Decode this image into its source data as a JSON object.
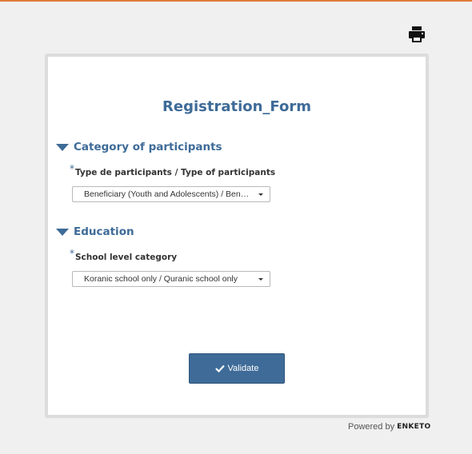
{
  "form": {
    "title": "Registration_Form"
  },
  "groups": [
    {
      "label": "Category of participants",
      "question": {
        "required_mark": "*",
        "label": "Type de participants / Type of participants",
        "selected": "Beneficiary (Youth and Adolescents) / Beneficiary (Youth and Adolescents)"
      }
    },
    {
      "label": "Education",
      "question": {
        "required_mark": "*",
        "label": "School level category",
        "selected": "Koranic school only / Quranic school only"
      }
    }
  ],
  "actions": {
    "validate_label": "Validate"
  },
  "footer": {
    "powered_by": "Powered by",
    "brand": "ENKETO"
  },
  "icons": {
    "print": "printer-icon",
    "group_toggle": "caret-down-icon",
    "validate": "check-icon"
  },
  "colors": {
    "accent": "#3e6b98",
    "topbar": "#e07a3a",
    "background": "#f0f0f0"
  }
}
